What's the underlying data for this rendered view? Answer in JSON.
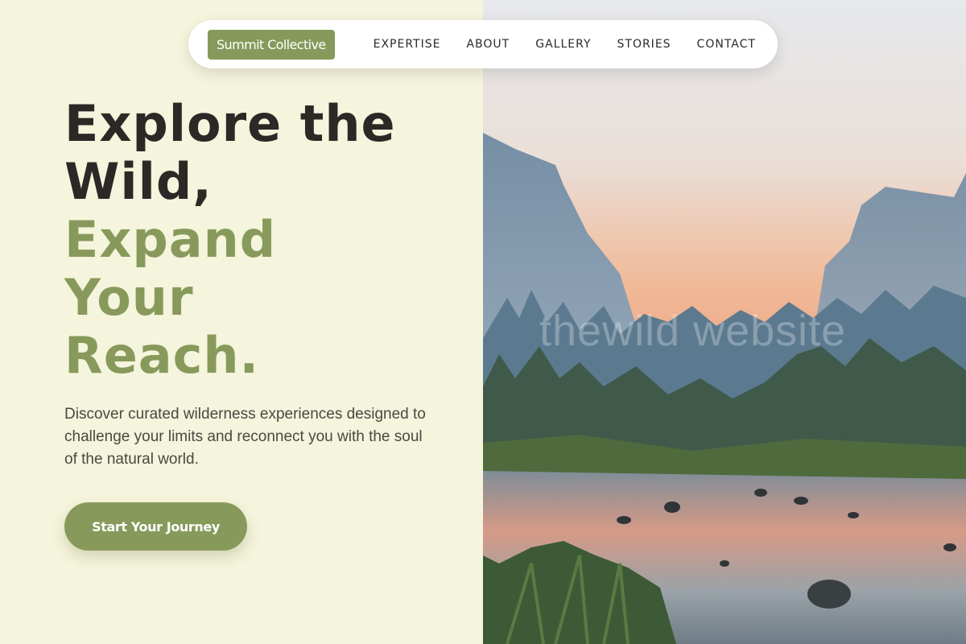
{
  "nav": {
    "brand": "Summit Collective",
    "links": [
      "EXPERTISE",
      "ABOUT",
      "GALLERY",
      "STORIES",
      "CONTACT"
    ]
  },
  "hero": {
    "title_lines": [
      "Explore the",
      "Wild,"
    ],
    "accent_lines": [
      "Expand",
      "Your",
      "Reach."
    ],
    "description": "Discover curated wilderness experiences designed to challenge your limits and reconnect you with the soul of the natural world.",
    "cta_label": "Start Your Journey"
  },
  "watermark": "thewild website",
  "colors": {
    "background": "#f5f4dc",
    "accent": "#889a5b",
    "text_dark": "#2b2926"
  }
}
